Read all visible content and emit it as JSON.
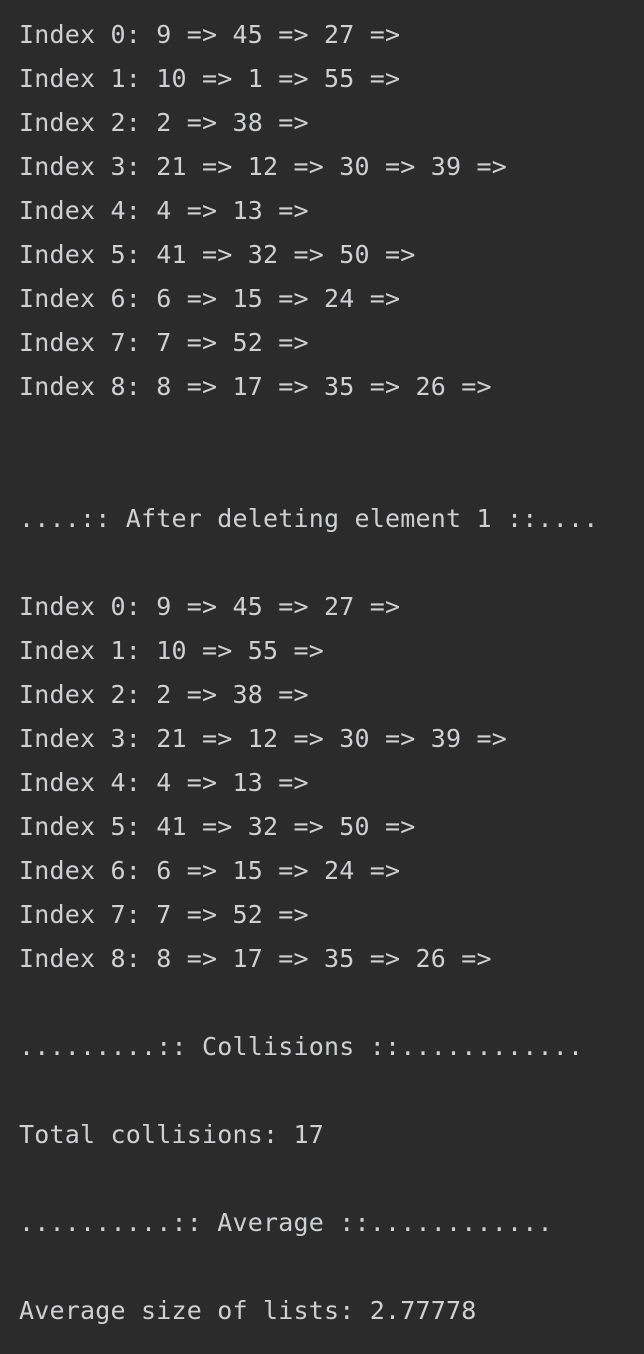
{
  "console": {
    "lines": [
      "Index 0: 9 => 45 => 27 =>",
      "Index 1: 10 => 1 => 55 =>",
      "Index 2: 2 => 38 =>",
      "Index 3: 21 => 12 => 30 => 39 =>",
      "Index 4: 4 => 13 =>",
      "Index 5: 41 => 32 => 50 =>",
      "Index 6: 6 => 15 => 24 =>",
      "Index 7: 7 => 52 =>",
      "Index 8: 8 => 17 => 35 => 26 =>",
      "....:: After deleting element 1 ::....",
      "Index 0: 9 => 45 => 27 =>",
      "Index 1: 10 => 55 =>",
      "Index 2: 2 => 38 =>",
      "Index 3: 21 => 12 => 30 => 39 =>",
      "Index 4: 4 => 13 =>",
      "Index 5: 41 => 32 => 50 =>",
      "Index 6: 6 => 15 => 24 =>",
      "Index 7: 7 => 52 =>",
      "Index 8: 8 => 17 => 35 => 26 =>",
      ".........:: Collisions ::............",
      "Total collisions: 17",
      "..........:: Average ::............",
      "Average size of lists: 2.77778"
    ]
  }
}
